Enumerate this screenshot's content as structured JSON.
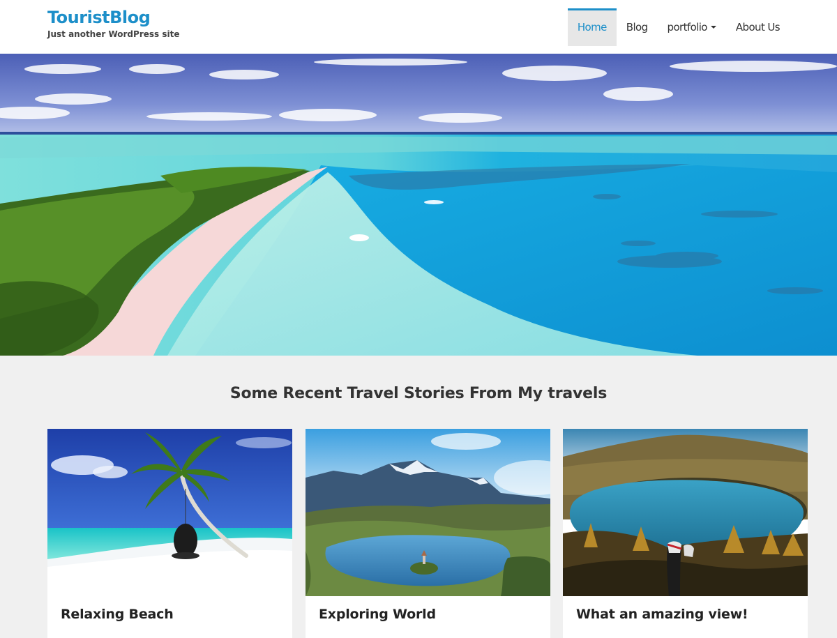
{
  "site": {
    "title": "TouristBlog",
    "tagline": "Just another WordPress site"
  },
  "nav": {
    "items": [
      {
        "label": "Home",
        "active": true
      },
      {
        "label": "Blog"
      },
      {
        "label": "portfolio",
        "has_dropdown": true
      },
      {
        "label": "About Us"
      }
    ]
  },
  "main": {
    "heading": "Some Recent Travel Stories From My travels",
    "posts": [
      {
        "title": "Relaxing Beach"
      },
      {
        "title": "Exploring World"
      },
      {
        "title": "What an amazing view!"
      }
    ]
  },
  "colors": {
    "accent": "#1d8fc9",
    "page_background": "#f0f0f0",
    "header_background": "#ffffff",
    "active_nav_background": "#e7e7e7"
  }
}
